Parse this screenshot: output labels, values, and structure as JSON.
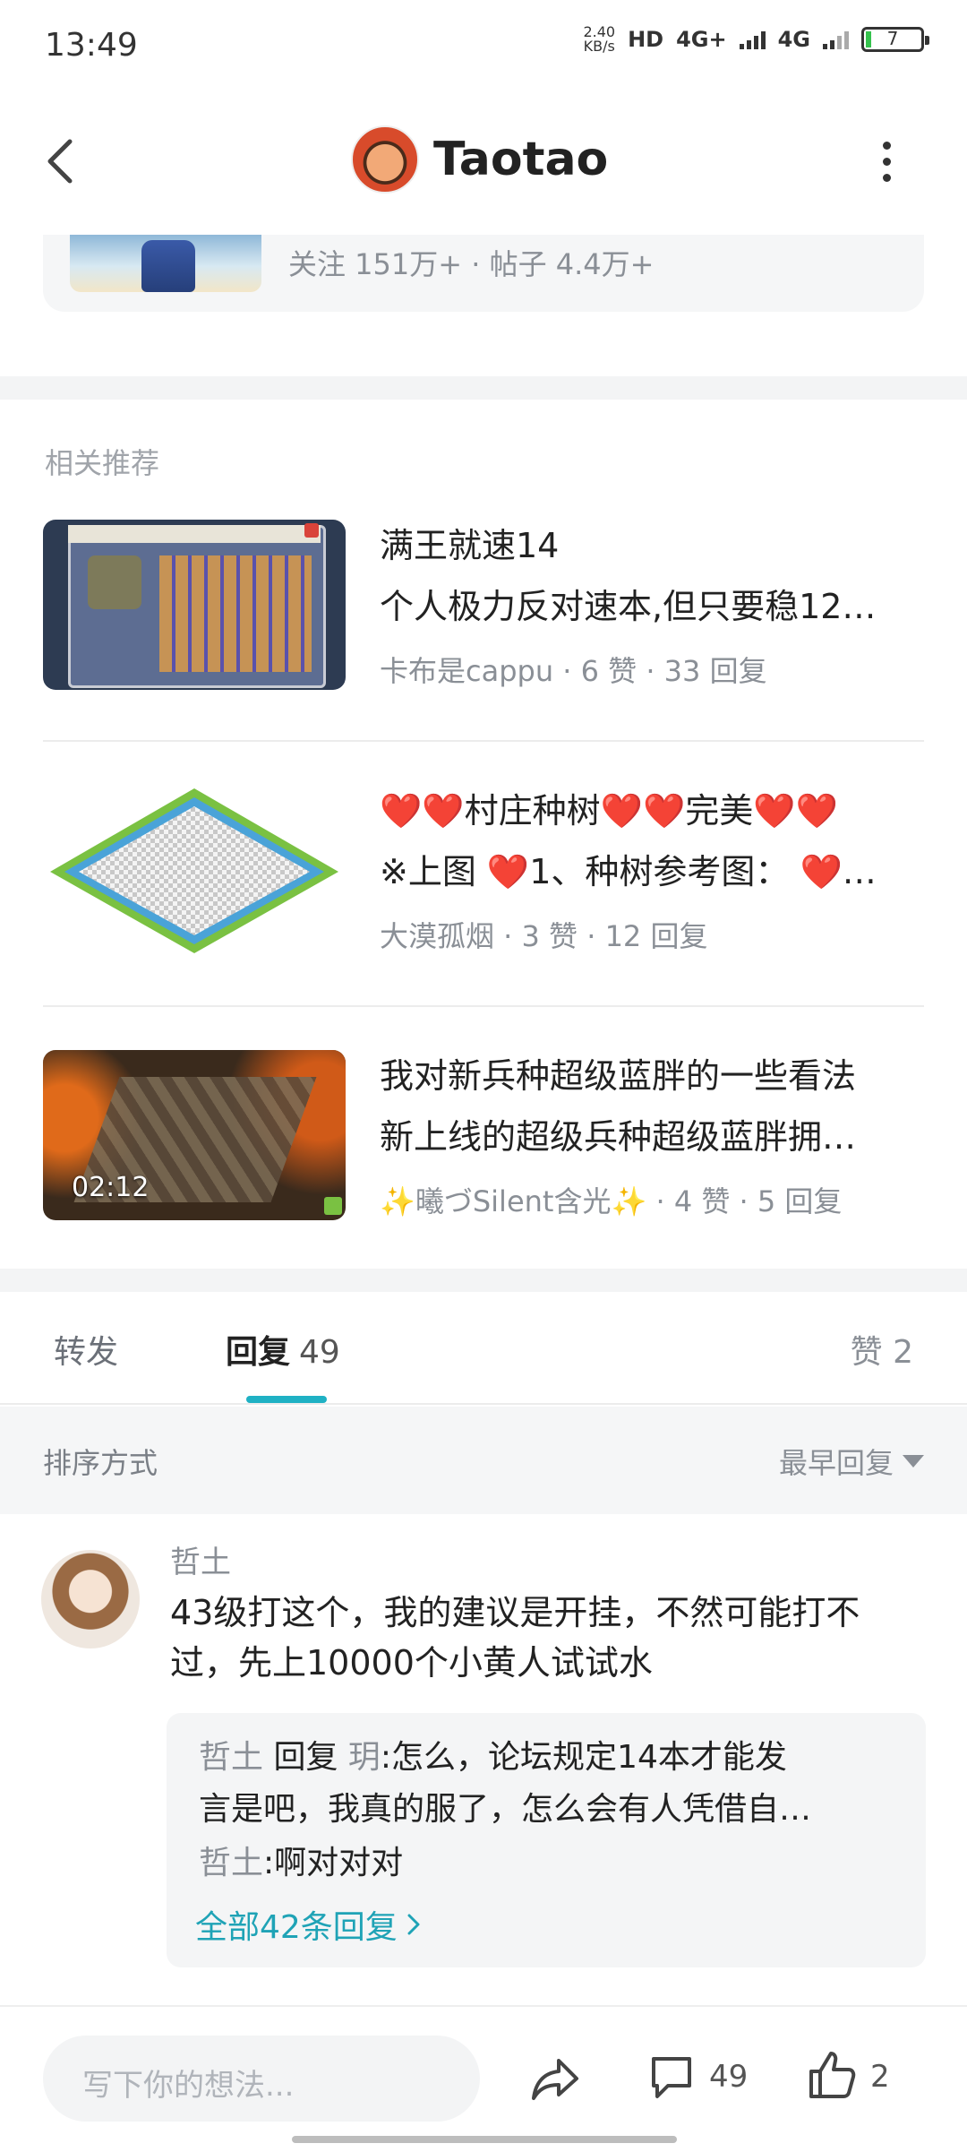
{
  "status_bar": {
    "time": "13:49",
    "net_speed_value": "2.40",
    "net_speed_unit": "KB/s",
    "hd_label": "HD",
    "sim1_type": "4G+",
    "sim2_type": "4G",
    "battery_level": "7"
  },
  "header": {
    "back_icon": "chevron-left-icon",
    "title": "Taotao",
    "more_icon": "more-vertical-icon"
  },
  "forum_card": {
    "stats": "关注 151万+ · 帖子 4.4万+"
  },
  "related": {
    "section_title": "相关推荐",
    "items": [
      {
        "title": "满王就速14",
        "excerpt": "个人极力反对速本,但只要稳12…",
        "meta": "卡布是cappu · 6 赞 · 33 回复"
      },
      {
        "title": "❤️❤️村庄种树❤️❤️完美❤️❤️",
        "excerpt": "※上图 ❤️1、种树参考图： ❤️…",
        "meta": "大漠孤烟 · 3 赞 · 12 回复"
      },
      {
        "title": "我对新兵种超级蓝胖的一些看法",
        "excerpt": "新上线的超级兵种超级蓝胖拥…",
        "meta": "✨曦づSilent含光✨ · 4 赞 · 5 回复",
        "video_duration": "02:12"
      }
    ]
  },
  "tabs": {
    "forward": "转发",
    "reply": "回复",
    "reply_count": "49",
    "like": "赞 2"
  },
  "sort": {
    "label": "排序方式",
    "value": "最早回复"
  },
  "comment": {
    "author": "哲土",
    "body": "43级打这个，我的建议是开挂，不然可能打不过，先上10000个小黄人试试水",
    "replies": [
      {
        "who": "哲土",
        "verb": " 回复 ",
        "target": "玥",
        "text": ":怎么，论坛规定14本才能发"
      },
      {
        "text": "言是吧，我真的服了，怎么会有人凭借自…"
      },
      {
        "who": "哲土",
        "text": ":啊对对对"
      }
    ],
    "all_replies": "全部42条回复"
  },
  "bottom_bar": {
    "input_placeholder": "写下你的想法...",
    "comment_count": "49",
    "like_count": "2"
  },
  "colors": {
    "accent": "#1fb1c4",
    "link": "#1fa3b6",
    "muted": "#8a8f96"
  }
}
